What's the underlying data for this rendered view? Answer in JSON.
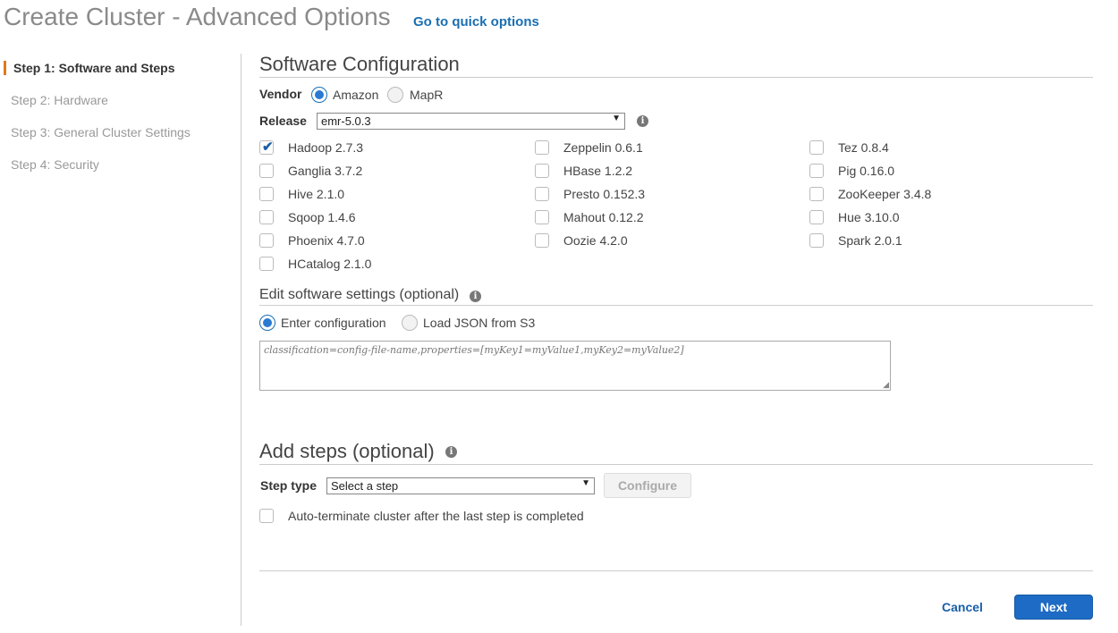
{
  "header": {
    "title": "Create Cluster - Advanced Options",
    "quick_link": "Go to quick options"
  },
  "sidebar": {
    "steps": [
      {
        "label": "Step 1: Software and Steps",
        "active": true
      },
      {
        "label": "Step 2: Hardware",
        "active": false
      },
      {
        "label": "Step 3: General Cluster Settings",
        "active": false
      },
      {
        "label": "Step 4: Security",
        "active": false
      }
    ]
  },
  "software": {
    "title": "Software Configuration",
    "vendor_label": "Vendor",
    "vendor_options": [
      "Amazon",
      "MapR"
    ],
    "vendor_selected": "Amazon",
    "release_label": "Release",
    "release_value": "emr-5.0.3",
    "applications": [
      {
        "label": "Hadoop 2.7.3",
        "checked": true
      },
      {
        "label": "Zeppelin 0.6.1",
        "checked": false
      },
      {
        "label": "Tez 0.8.4",
        "checked": false
      },
      {
        "label": "Ganglia 3.7.2",
        "checked": false
      },
      {
        "label": "HBase 1.2.2",
        "checked": false
      },
      {
        "label": "Pig 0.16.0",
        "checked": false
      },
      {
        "label": "Hive 2.1.0",
        "checked": false
      },
      {
        "label": "Presto 0.152.3",
        "checked": false
      },
      {
        "label": "ZooKeeper 3.4.8",
        "checked": false
      },
      {
        "label": "Sqoop 1.4.6",
        "checked": false
      },
      {
        "label": "Mahout 0.12.2",
        "checked": false
      },
      {
        "label": "Hue 3.10.0",
        "checked": false
      },
      {
        "label": "Phoenix 4.7.0",
        "checked": false
      },
      {
        "label": "Oozie 4.2.0",
        "checked": false
      },
      {
        "label": "Spark 2.0.1",
        "checked": false
      },
      {
        "label": "HCatalog 2.1.0",
        "checked": false
      }
    ]
  },
  "edit_settings": {
    "title": "Edit software settings (optional)",
    "options": [
      "Enter configuration",
      "Load JSON from S3"
    ],
    "selected": "Enter configuration",
    "placeholder": "classification=config-file-name,properties=[myKey1=myValue1,myKey2=myValue2]"
  },
  "steps_section": {
    "title": "Add steps (optional)",
    "step_type_label": "Step type",
    "step_type_value": "Select a step",
    "configure_label": "Configure",
    "auto_terminate_label": "Auto-terminate cluster after the last step is completed",
    "auto_terminate_checked": false
  },
  "footer": {
    "cancel_label": "Cancel",
    "next_label": "Next"
  }
}
